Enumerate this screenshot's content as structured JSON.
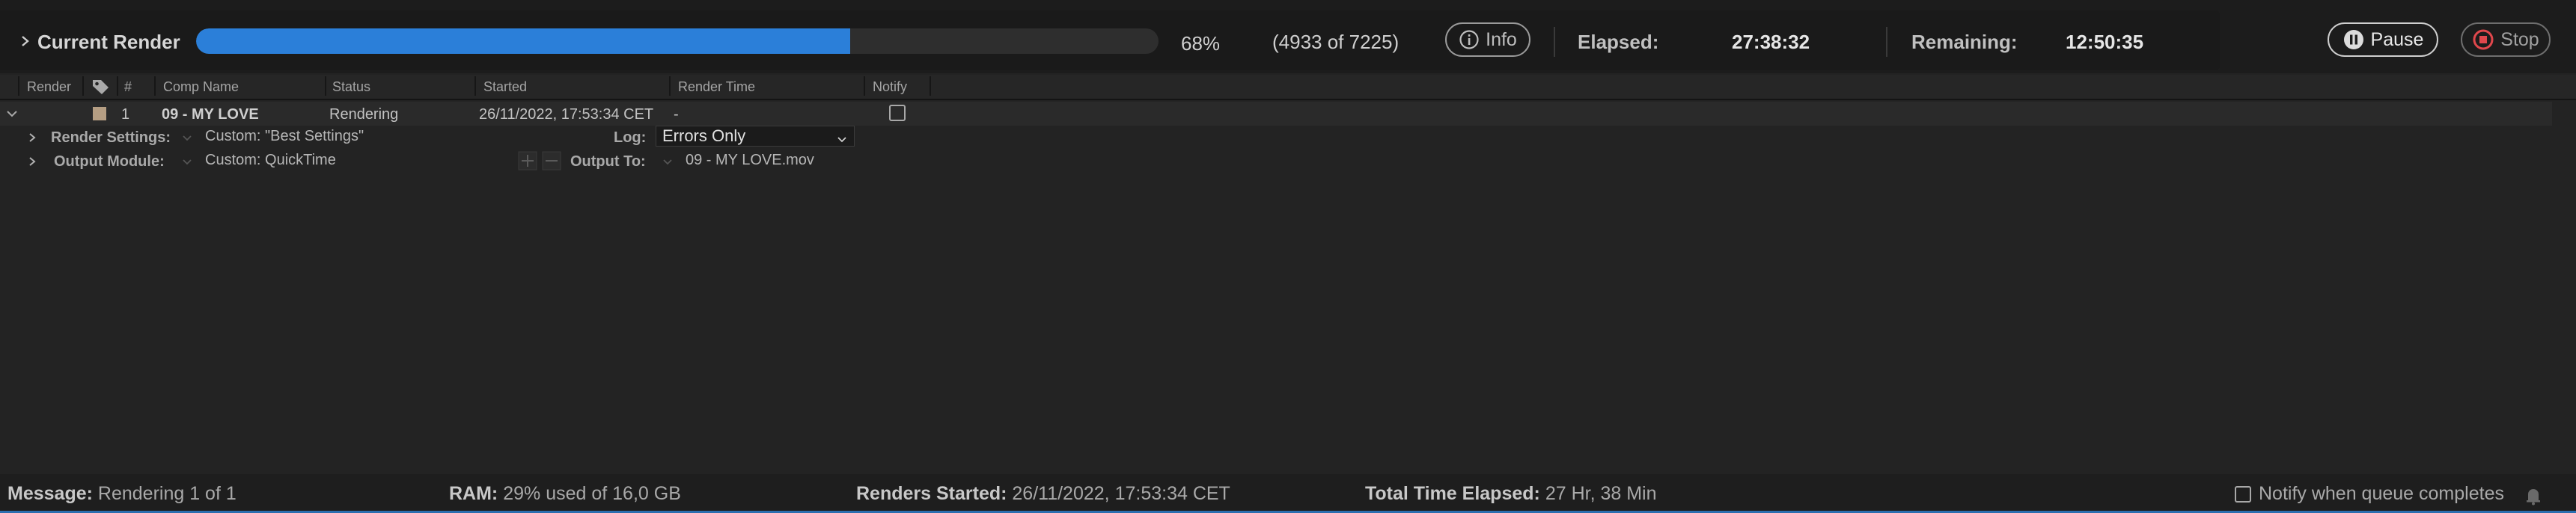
{
  "current_render": {
    "title": "Current Render",
    "progress_percent": 68,
    "progress_label": "68%",
    "frames_label": "(4933 of 7225)",
    "info_label": "Info",
    "elapsed_label": "Elapsed:",
    "elapsed_value": "27:38:32",
    "remaining_label": "Remaining:",
    "remaining_value": "12:50:35",
    "pause_label": "Pause",
    "stop_label": "Stop"
  },
  "columns": {
    "render": "Render",
    "num": "#",
    "comp_name": "Comp Name",
    "status": "Status",
    "started": "Started",
    "render_time": "Render Time",
    "notify": "Notify"
  },
  "queue_item": {
    "index": "1",
    "comp_name": "09 - MY LOVE",
    "status": "Rendering",
    "started": "26/11/2022, 17:53:34 CET",
    "render_time": "-",
    "label_color": "#b59e83"
  },
  "render_settings": {
    "label": "Render Settings:",
    "value": "Custom: \"Best Settings\"",
    "log_label": "Log:",
    "log_value": "Errors Only"
  },
  "output_module": {
    "label": "Output Module:",
    "value": "Custom: QuickTime",
    "output_to_label": "Output To:",
    "output_to_value": "09 - MY LOVE.mov"
  },
  "footer": {
    "message_label": "Message:",
    "message_value": "Rendering 1 of 1",
    "ram_label": "RAM:",
    "ram_value": "29% used of 16,0 GB",
    "renders_started_label": "Renders Started:",
    "renders_started_value": "26/11/2022, 17:53:34 CET",
    "total_elapsed_label": "Total Time Elapsed:",
    "total_elapsed_value": "27 Hr, 38 Min",
    "notify_label": "Notify when queue completes"
  },
  "colors": {
    "progress": "#2b7fd9",
    "background": "#232323",
    "stop_icon": "#e0474c"
  }
}
